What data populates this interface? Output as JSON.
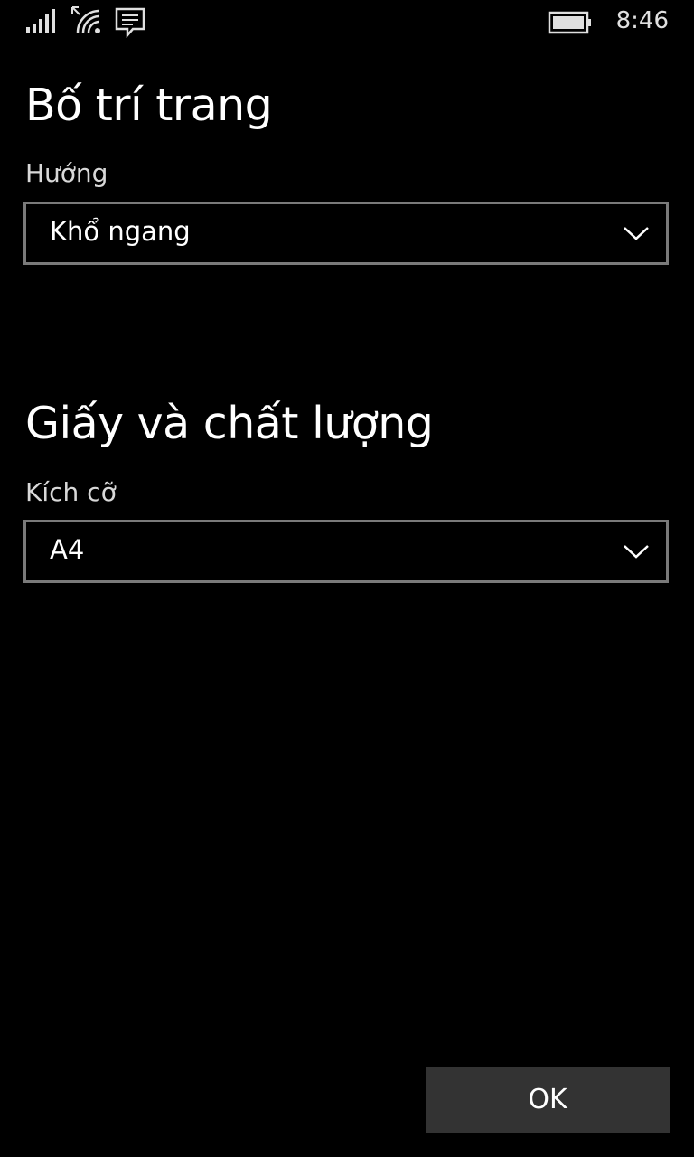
{
  "status_bar": {
    "time": "8:46",
    "icons": [
      "signal-icon",
      "wifi-icon",
      "message-icon",
      "battery-icon"
    ]
  },
  "page_layout": {
    "title": "Bố trí trang",
    "orientation_label": "Hướng",
    "orientation_value": "Khổ ngang"
  },
  "paper_quality": {
    "title": "Giấy và chất lượng",
    "size_label": "Kích cỡ",
    "size_value": "A4"
  },
  "actions": {
    "ok_label": "OK"
  },
  "colors": {
    "background": "#000000",
    "border": "#7a7a7a",
    "button": "#333333",
    "text": "#ffffff"
  }
}
